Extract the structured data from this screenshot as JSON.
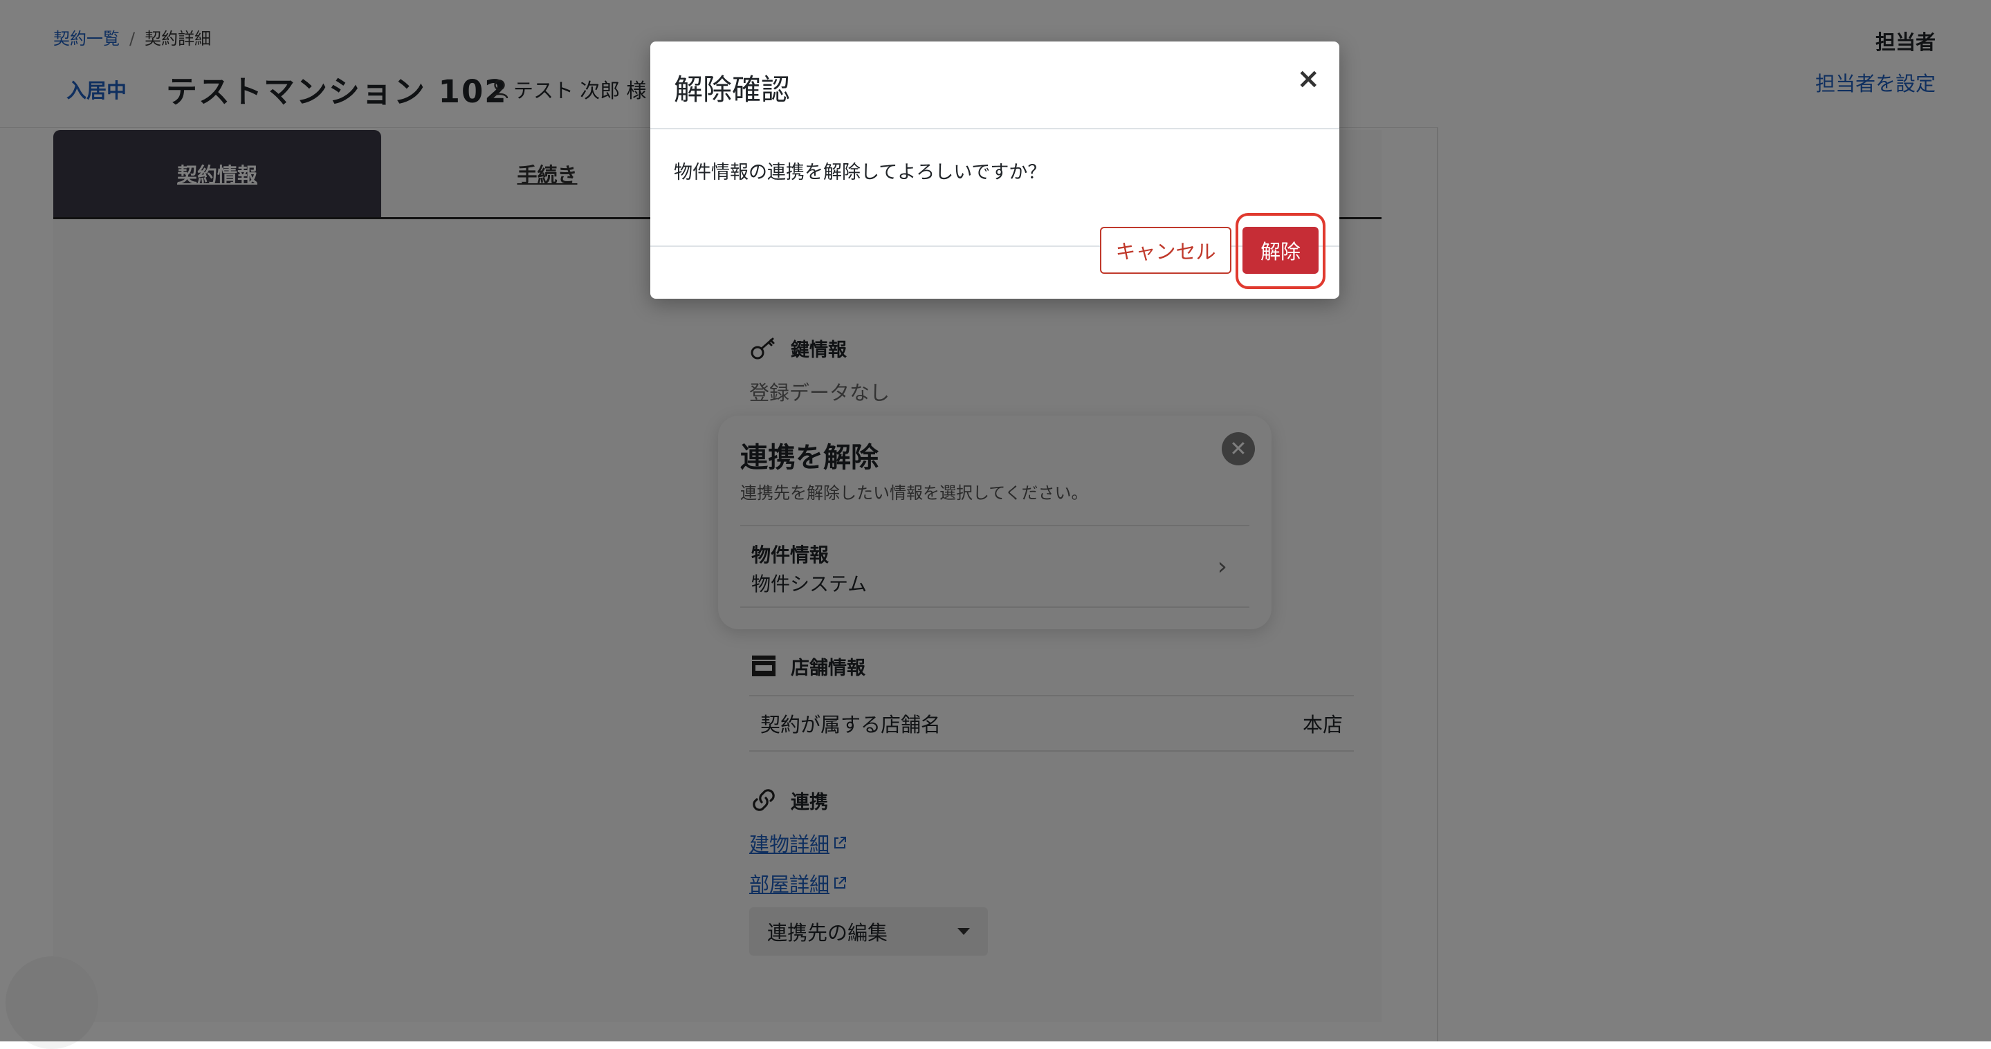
{
  "breadcrumb": {
    "parent": "契約一覧",
    "separator": "/",
    "current": "契約詳細"
  },
  "header": {
    "status": "入居中",
    "title": "テストマンション 102",
    "tenant": "テスト 次郎 様",
    "assignee_label": "担当者",
    "assignee_link": "担当者を設定"
  },
  "tabs": [
    {
      "label": "契約情報"
    },
    {
      "label": "手続き"
    }
  ],
  "key_info": {
    "heading": "鍵情報",
    "empty": "登録データなし"
  },
  "store_info": {
    "heading": "店舗情報",
    "row_label": "契約が属する店舗名",
    "row_value": "本店"
  },
  "link_section": {
    "heading": "連携",
    "links": [
      {
        "label": "建物詳細"
      },
      {
        "label": "部屋詳細"
      }
    ],
    "edit_select": "連携先の編集"
  },
  "popover": {
    "title": "連携を解除",
    "subtitle": "連携先を解除したい情報を選択してください。",
    "item_title": "物件情報",
    "item_sub": "物件システム"
  },
  "modal": {
    "title": "解除確認",
    "close": "×",
    "message": "物件情報の連携を解除してよろしいですか？",
    "cancel": "キャンセル",
    "confirm": "解除"
  },
  "colors": {
    "accent": "#1f5fbf",
    "danger": "#c62d36",
    "highlight": "#e03a2f",
    "active_tab": "#3a3846"
  }
}
